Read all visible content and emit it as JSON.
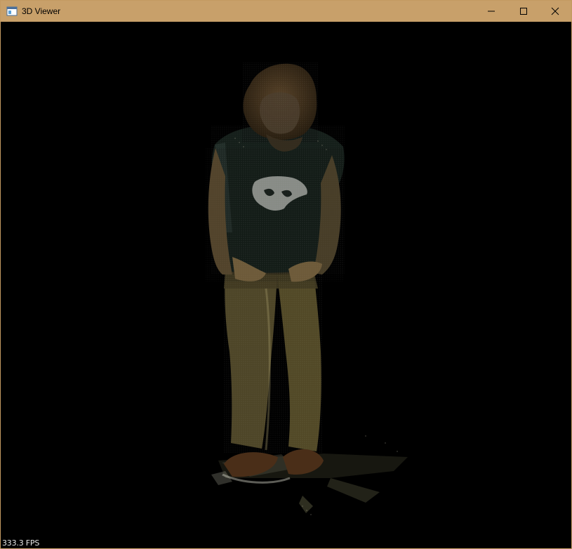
{
  "window": {
    "title": "3D Viewer",
    "icon": "app-window-icon",
    "controls": {
      "minimize_icon": "minimize-icon",
      "maximize_icon": "maximize-icon",
      "close_icon": "close-icon"
    }
  },
  "viewport": {
    "content": "point-cloud",
    "background_color": "#000000",
    "fps_readout": "333.3 FPS"
  },
  "colors": {
    "titlebar": "#c8a06a",
    "border": "#c49a62"
  }
}
